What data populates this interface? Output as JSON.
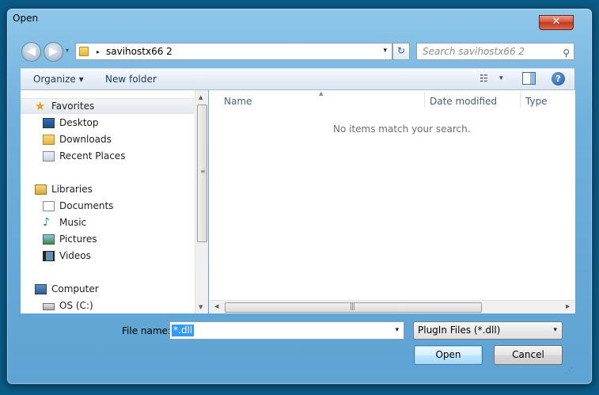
{
  "window": {
    "title": "Open",
    "close_glyph": "✕"
  },
  "nav": {
    "back_glyph": "◀",
    "forward_glyph": "▶",
    "history_glyph": "▾",
    "address_path": "savihostx66 2",
    "crumb_glyph": "▸",
    "address_dropdown_glyph": "▾",
    "refresh_glyph": "↻",
    "search_placeholder": "Search savihostx66 2",
    "search_glyph": "⚲"
  },
  "toolbar": {
    "organize_label": "Organize ▾",
    "new_folder_label": "New folder",
    "views_glyph": "☷",
    "views_dropdown_glyph": "▾",
    "help_glyph": "?"
  },
  "sidebar": {
    "favorites": {
      "label": "Favorites",
      "icon": "star-icon",
      "items": [
        {
          "label": "Desktop",
          "icon": "desktop-icon"
        },
        {
          "label": "Downloads",
          "icon": "downloads-folder-icon"
        },
        {
          "label": "Recent Places",
          "icon": "recent-places-icon"
        }
      ]
    },
    "libraries": {
      "label": "Libraries",
      "icon": "libraries-icon",
      "items": [
        {
          "label": "Documents",
          "icon": "documents-icon"
        },
        {
          "label": "Music",
          "icon": "music-icon"
        },
        {
          "label": "Pictures",
          "icon": "pictures-icon"
        },
        {
          "label": "Videos",
          "icon": "videos-icon"
        }
      ]
    },
    "computer": {
      "label": "Computer",
      "icon": "computer-icon",
      "items": [
        {
          "label": "OS (C:)",
          "icon": "drive-icon"
        }
      ]
    },
    "star_glyph": "★",
    "music_glyph": "♪"
  },
  "file_list": {
    "columns": [
      "Name",
      "Date modified",
      "Type"
    ],
    "sort_glyph": "▲",
    "empty_message": "No items match your search."
  },
  "scrollbars": {
    "up_glyph": "▲",
    "down_glyph": "▼",
    "left_glyph": "◀",
    "right_glyph": "▶",
    "grip_glyph": "≡",
    "hgrip_glyph": "|||"
  },
  "bottom": {
    "filename_label": "File name:",
    "filename_value": "*.dll",
    "filename_dropdown_glyph": "▾",
    "filetype_value": "PlugIn Files (*.dll)",
    "filetype_dropdown_glyph": "▾",
    "open_button": "Open",
    "cancel_button": "Cancel",
    "resize_grip_glyph": "⋰"
  },
  "colors": {
    "window_frame": "#6fb0dc",
    "selection": "#3399ff",
    "background": "#0a5b87"
  }
}
